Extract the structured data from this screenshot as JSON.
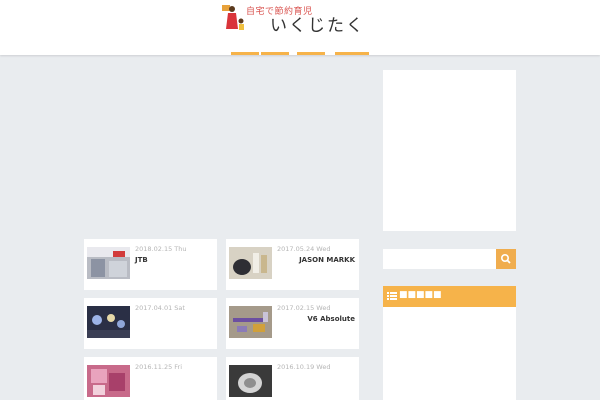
{
  "header": {
    "logo_top": "自宅で節約育児",
    "logo_main": "いくじたく",
    "nav_tabs": [
      "",
      "",
      "",
      ""
    ]
  },
  "search": {
    "placeholder": ""
  },
  "widget": {
    "title": "■■■■■"
  },
  "posts": [
    {
      "date": "2018.02.15 Thu",
      "title": "JTB",
      "icon": "thumbnail-store-photo"
    },
    {
      "date": "2017.05.24 Wed",
      "title": "JASON MARKK",
      "icon": "thumbnail-shoe-cleaning-photo"
    },
    {
      "date": "2017.04.01 Sat",
      "title": "",
      "icon": "thumbnail-night-lights-photo"
    },
    {
      "date": "2017.02.15 Wed",
      "title": "V6 Absolute",
      "icon": "thumbnail-vacuum-parts-photo"
    },
    {
      "date": "2016.11.25 Fri",
      "title": "",
      "icon": "thumbnail-baby-clothes-photo"
    },
    {
      "date": "2016.10.19 Wed",
      "title": "",
      "icon": "thumbnail-cat-photo"
    }
  ],
  "colors": {
    "accent": "#f6b34a",
    "search_button": "#f0ad4e",
    "background": "#e9ecef"
  }
}
